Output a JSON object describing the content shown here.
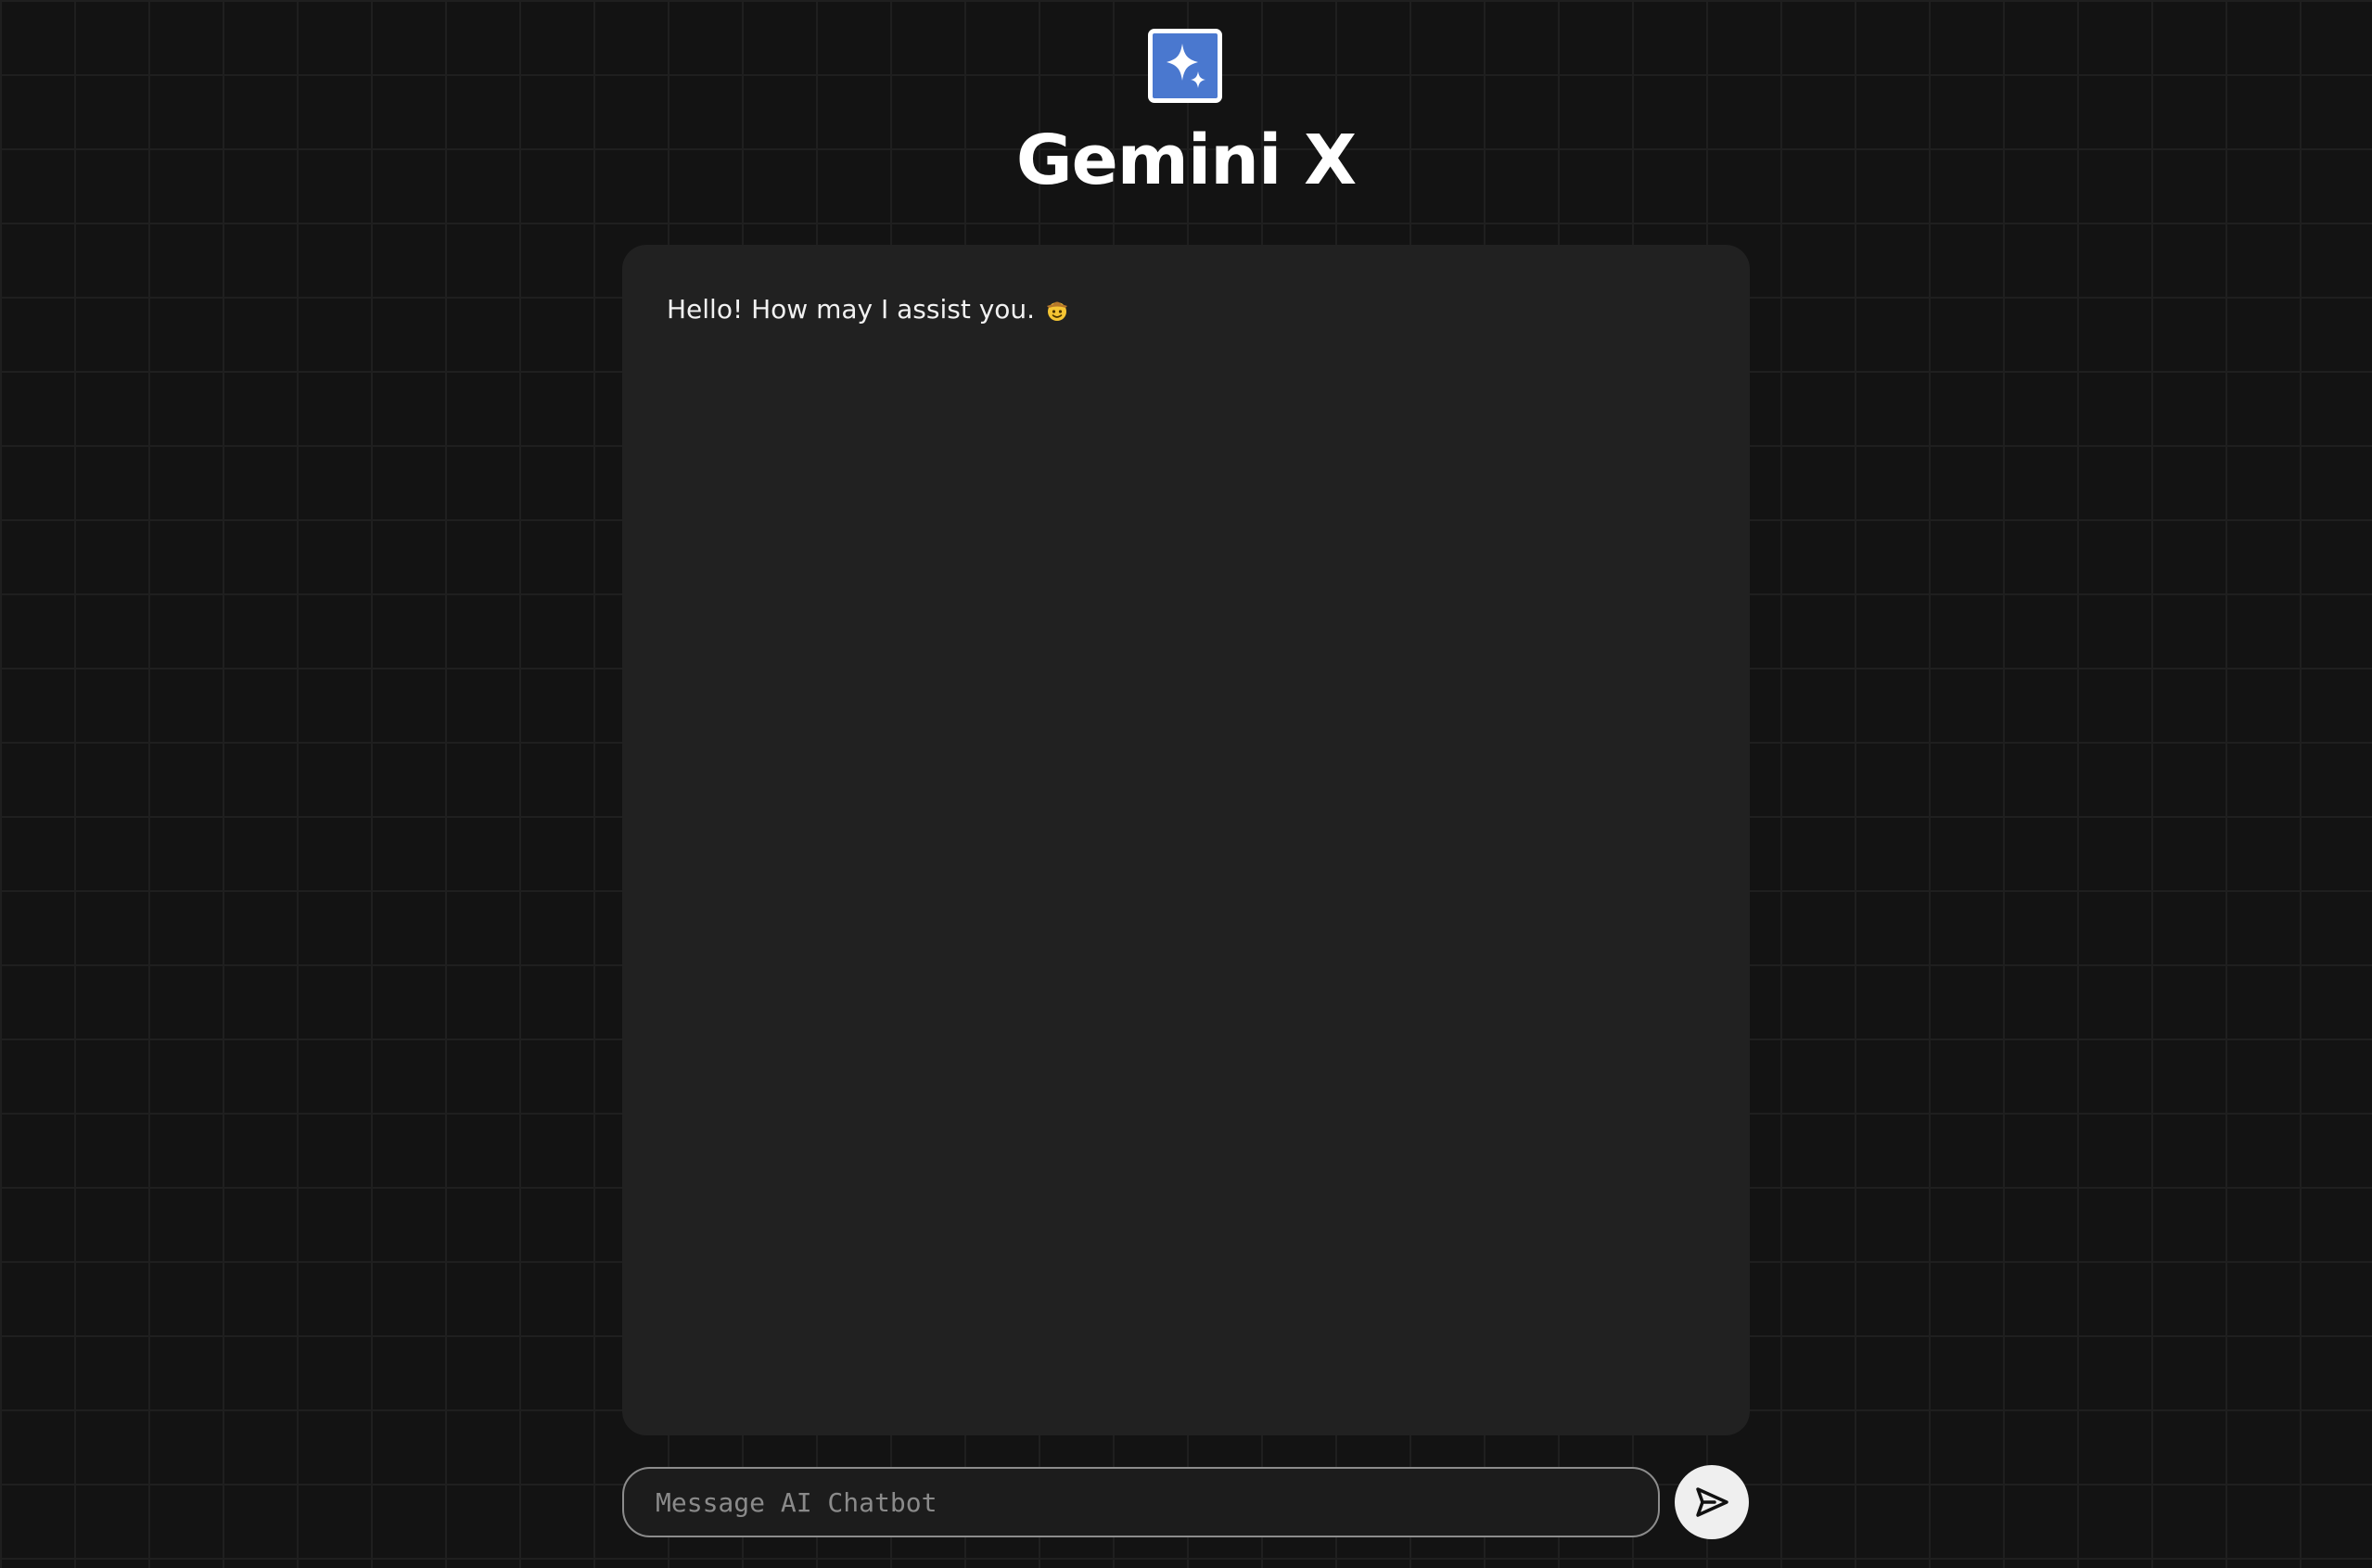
{
  "header": {
    "logo_icon": "sparkle-icon",
    "title": "Gemini X"
  },
  "chat": {
    "messages": [
      {
        "role": "bot",
        "text": "Hello! How may I assist you.",
        "emoji_icon": "cowboy-face-icon"
      }
    ]
  },
  "composer": {
    "placeholder": "Message AI Chatbot",
    "value": "",
    "send_icon": "send-arrow-icon"
  },
  "colors": {
    "background": "#131313",
    "grid": "#1f1f1f",
    "panel": "#212121",
    "logo": "#4a78cf",
    "send_button": "#efefef"
  }
}
